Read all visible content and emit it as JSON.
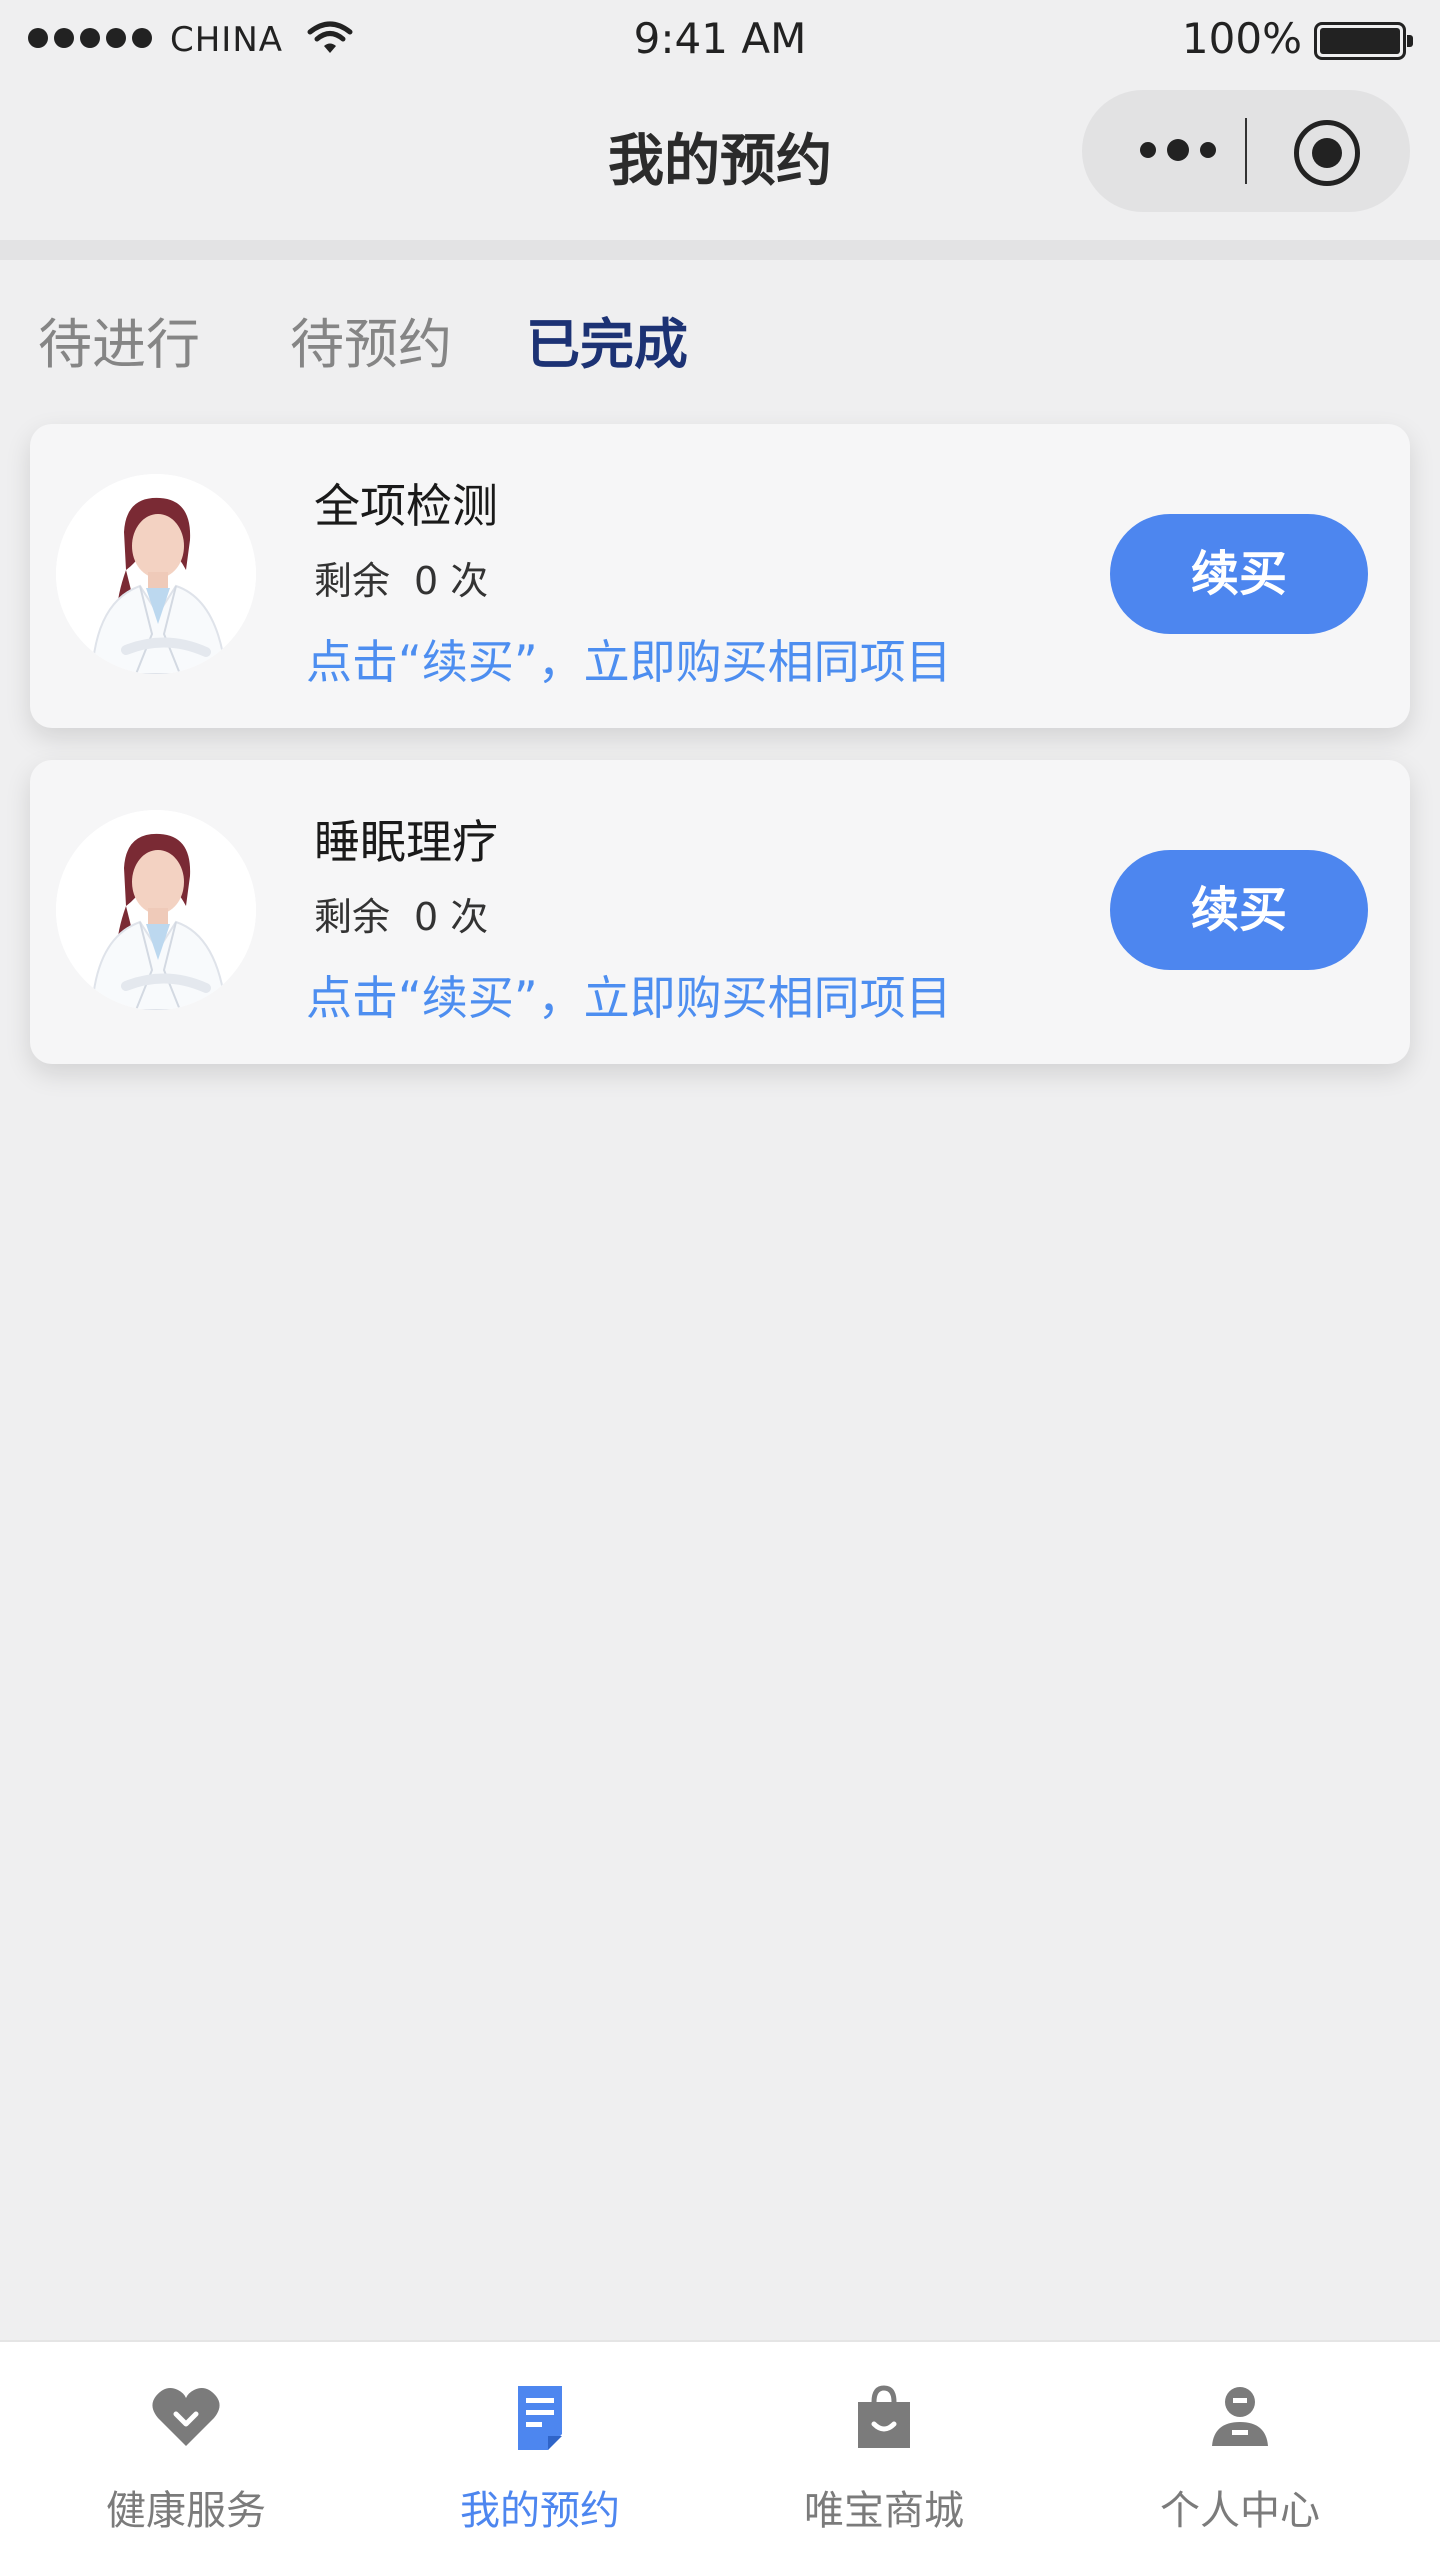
{
  "status_bar": {
    "carrier": "CHINA",
    "time": "9:41 AM",
    "battery": "100%",
    "battery_level": 1.0
  },
  "nav": {
    "title": "我的预约",
    "more_icon": "more-dots-icon",
    "close_icon": "target-close-icon"
  },
  "tabs": [
    {
      "label": "待进行",
      "active": false
    },
    {
      "label": "待预约",
      "active": false
    },
    {
      "label": "已完成",
      "active": true
    }
  ],
  "cards": [
    {
      "name": "全项检测",
      "remaining_label": "剩余",
      "remaining_count": "0",
      "remaining_unit": "次",
      "hint": "点击“续买”，立即购买相同项目",
      "button": "续买"
    },
    {
      "name": "睡眠理疗",
      "remaining_label": "剩余",
      "remaining_count": "0",
      "remaining_unit": "次",
      "hint": "点击“续买”，立即购买相同项目",
      "button": "续买"
    }
  ],
  "tab_bar": [
    {
      "label": "健康服务",
      "icon": "heart-icon",
      "active": false
    },
    {
      "label": "我的预约",
      "icon": "document-icon",
      "active": true
    },
    {
      "label": "唯宝商城",
      "icon": "shopping-bag-icon",
      "active": false
    },
    {
      "label": "个人中心",
      "icon": "person-icon",
      "active": false
    }
  ],
  "colors": {
    "accent": "#4d86ef",
    "hint": "#4d8ef0",
    "active_tab": "#1c3274",
    "inactive": "#858585",
    "background": "#efeff0"
  }
}
